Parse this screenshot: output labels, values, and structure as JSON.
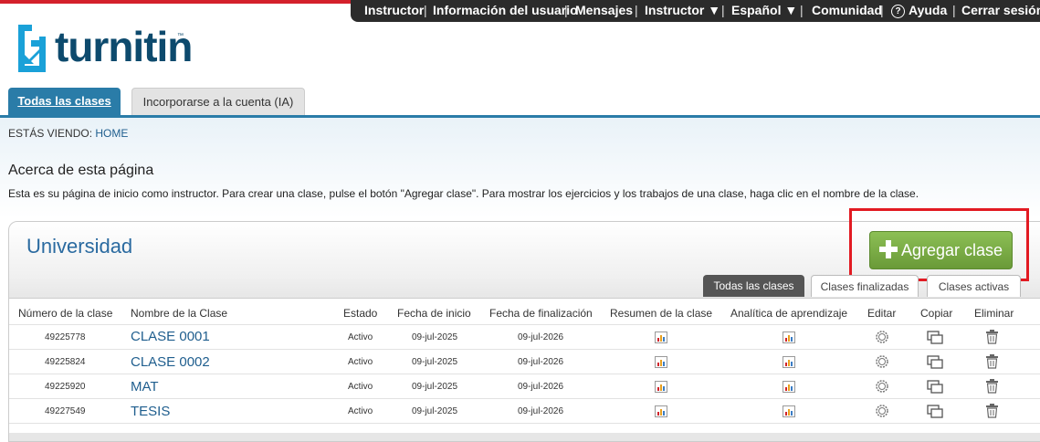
{
  "topnav": {
    "items": [
      "Instructor",
      "Información del usuario",
      "Mensajes",
      "Instructor ▼",
      "Español ▼",
      "Comunidad",
      "Ayuda",
      "Cerrar sesión"
    ],
    "separator": "|",
    "help_glyph": "?"
  },
  "logo": {
    "text": "turnitin",
    "tm": "™"
  },
  "tabs": {
    "active": "Todas las clases",
    "other": "Incorporarse a la cuenta (IA)"
  },
  "breadcrumb": {
    "prefix": "ESTÁS VIENDO:",
    "link": "HOME"
  },
  "about": {
    "title": "Acerca de esta página",
    "text": "Esta es su página de inicio como instructor. Para crear una clase, pulse el botón \"Agregar clase\". Para mostrar los ejercicios y los trabajos de una clase, haga clic en el nombre de la clase."
  },
  "panel": {
    "title": "Universidad",
    "add_button": "Agregar clase"
  },
  "filter_tabs": [
    "Todas las clases",
    "Clases finalizadas",
    "Clases activas"
  ],
  "table": {
    "headers": [
      "Número de la clase",
      "Nombre de la Clase",
      "Estado",
      "Fecha de inicio",
      "Fecha de finalización",
      "Resumen de la clase",
      "Analítica de aprendizaje",
      "Editar",
      "Copiar",
      "Eliminar"
    ],
    "rows": [
      {
        "id": "49225778",
        "name": "CLASE 0001",
        "status": "Activo",
        "start": "09-jul-2025",
        "end": "09-jul-2026"
      },
      {
        "id": "49225824",
        "name": "CLASE 0002",
        "status": "Activo",
        "start": "09-jul-2025",
        "end": "09-jul-2026"
      },
      {
        "id": "49225920",
        "name": "MAT",
        "status": "Activo",
        "start": "09-jul-2025",
        "end": "09-jul-2026"
      },
      {
        "id": "49227549",
        "name": "TESIS",
        "status": "Activo",
        "start": "09-jul-2025",
        "end": "09-jul-2026"
      }
    ]
  },
  "icons": {
    "summary": "bar-chart-icon",
    "analytics": "bar-chart-icon",
    "edit": "gear-icon",
    "copy": "copy-icon",
    "delete": "trash-icon"
  },
  "colors": {
    "accent": "#2a7ca8",
    "add_button": "#7aad45",
    "highlight": "#e21a22",
    "link": "#1f5e8e",
    "top_bar": "#2b2b2b"
  }
}
